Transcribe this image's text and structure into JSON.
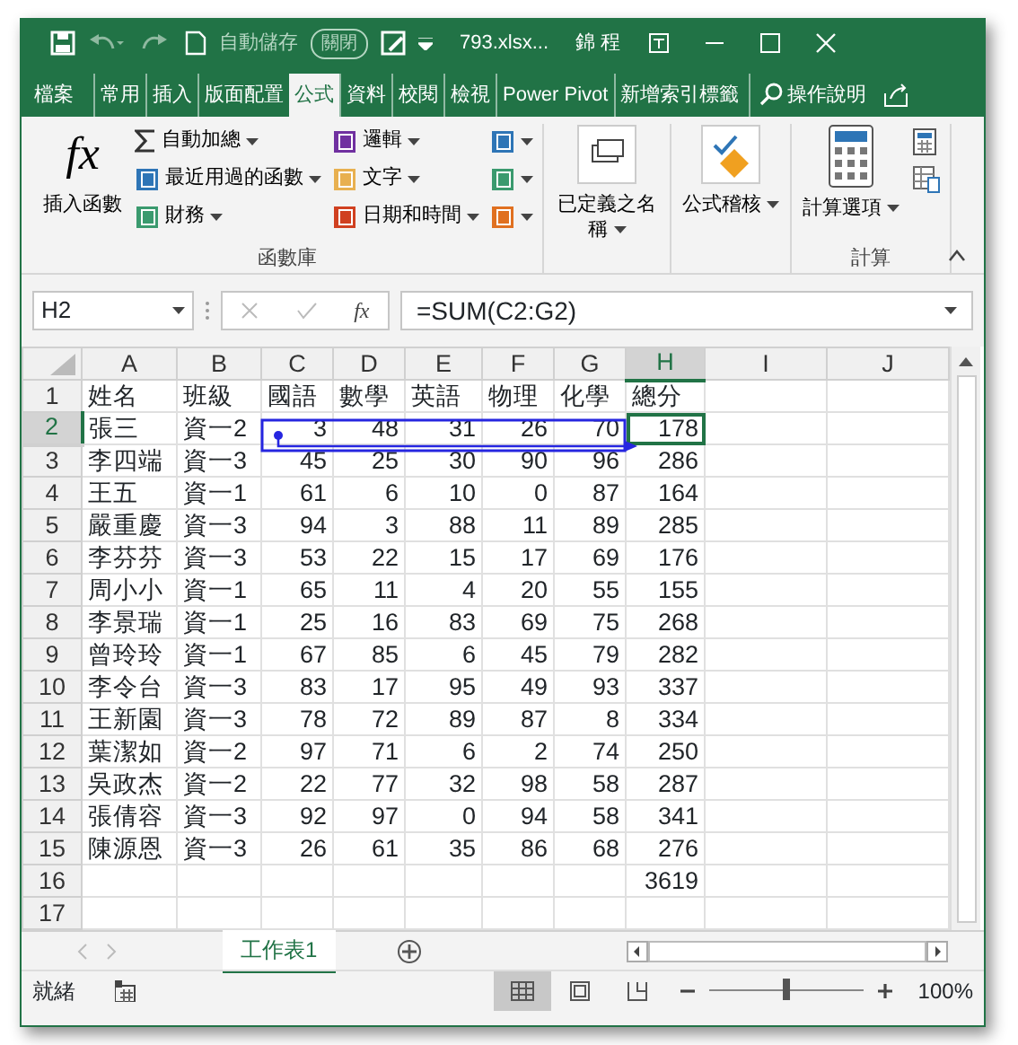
{
  "title_bar": {
    "autosave": {
      "label": "自動儲存",
      "toggle": "關閉",
      "on": false
    },
    "filename": "793.xlsx...",
    "user": "錦 程"
  },
  "tabs": [
    {
      "label": "檔案",
      "selected": false
    },
    {
      "label": "常用",
      "selected": false
    },
    {
      "label": "插入",
      "selected": false
    },
    {
      "label": "版面配置",
      "selected": false
    },
    {
      "label": "公式",
      "selected": true
    },
    {
      "label": "資料",
      "selected": false
    },
    {
      "label": "校閱",
      "selected": false
    },
    {
      "label": "檢視",
      "selected": false
    },
    {
      "label": "Power Pivot",
      "selected": false
    },
    {
      "label": "新增索引標籤",
      "selected": false
    }
  ],
  "tell_me": "操作說明",
  "ribbon": {
    "groups": [
      {
        "label": "函數庫",
        "items": [
          {
            "kind": "fx",
            "label": "插入函數",
            "dropdown": false
          },
          {
            "kind": "sum",
            "label": "自動加總",
            "dropdown": true
          },
          {
            "kind": "book",
            "color": "#2e75b6",
            "label": "最近用過的函數",
            "dropdown": true
          },
          {
            "kind": "book",
            "color": "#3a9a6e",
            "label": "財務",
            "dropdown": true
          },
          {
            "kind": "book",
            "color": "#7030a0",
            "label": "邏輯",
            "dropdown": true
          },
          {
            "kind": "book",
            "color": "#e8b050",
            "label": "文字",
            "dropdown": true
          },
          {
            "kind": "book",
            "color": "#d04020",
            "label": "日期和時間",
            "dropdown": true
          },
          {
            "kind": "book",
            "color": "#2e75b6",
            "dropdown": true
          },
          {
            "kind": "book",
            "color": "#3a9a6e",
            "dropdown": true
          },
          {
            "kind": "book",
            "color": "#e07020",
            "dropdown": true
          }
        ]
      },
      {
        "items": [
          {
            "kind": "names",
            "label": "已定義之名稱",
            "dropdown": true
          }
        ]
      },
      {
        "items": [
          {
            "kind": "audit",
            "label": "公式稽核",
            "dropdown": true
          }
        ]
      },
      {
        "label": "計算",
        "items": [
          {
            "kind": "calc_options",
            "label": "計算選項",
            "dropdown": true
          },
          {
            "kind": "calc"
          },
          {
            "kind": "sheet_calc"
          }
        ]
      }
    ]
  },
  "formula_bar": {
    "name_box": "H2",
    "fx_button": "fx",
    "formula": "=SUM(C2:G2)"
  },
  "columns": [
    {
      "label": "A",
      "selected": false
    },
    {
      "label": "B",
      "selected": false
    },
    {
      "label": "C",
      "selected": false
    },
    {
      "label": "D",
      "selected": false
    },
    {
      "label": "E",
      "selected": false
    },
    {
      "label": "F",
      "selected": false
    },
    {
      "label": "G",
      "selected": false
    },
    {
      "label": "H",
      "selected": true
    },
    {
      "label": "I",
      "selected": false
    },
    {
      "label": "J",
      "selected": false
    }
  ],
  "rows": [
    {
      "header": "1",
      "selected": false,
      "cells": [
        "姓名",
        "班級",
        "國語",
        "數學",
        "英語",
        "物理",
        "化學",
        "總分"
      ]
    },
    {
      "header": "2",
      "selected": true,
      "trace_precedents": true,
      "cells": [
        "張三",
        "資一2",
        "3",
        "48",
        "31",
        "26",
        "70",
        "178"
      ]
    },
    {
      "header": "3",
      "selected": false,
      "cells": [
        "李四端",
        "資一3",
        "45",
        "25",
        "30",
        "90",
        "96",
        "286"
      ]
    },
    {
      "header": "4",
      "selected": false,
      "cells": [
        "王五",
        "資一1",
        "61",
        "6",
        "10",
        "0",
        "87",
        "164"
      ]
    },
    {
      "header": "5",
      "selected": false,
      "cells": [
        "嚴重慶",
        "資一3",
        "94",
        "3",
        "88",
        "11",
        "89",
        "285"
      ]
    },
    {
      "header": "6",
      "selected": false,
      "cells": [
        "李芬芬",
        "資一3",
        "53",
        "22",
        "15",
        "17",
        "69",
        "176"
      ]
    },
    {
      "header": "7",
      "selected": false,
      "cells": [
        "周小小",
        "資一1",
        "65",
        "11",
        "4",
        "20",
        "55",
        "155"
      ]
    },
    {
      "header": "8",
      "selected": false,
      "cells": [
        "李景瑞",
        "資一1",
        "25",
        "16",
        "83",
        "69",
        "75",
        "268"
      ]
    },
    {
      "header": "9",
      "selected": false,
      "cells": [
        "曾玲玲",
        "資一1",
        "67",
        "85",
        "6",
        "45",
        "79",
        "282"
      ]
    },
    {
      "header": "10",
      "selected": false,
      "cells": [
        "李令台",
        "資一3",
        "83",
        "17",
        "95",
        "49",
        "93",
        "337"
      ]
    },
    {
      "header": "11",
      "selected": false,
      "cells": [
        "王新園",
        "資一3",
        "78",
        "72",
        "89",
        "87",
        "8",
        "334"
      ]
    },
    {
      "header": "12",
      "selected": false,
      "cells": [
        "葉潔如",
        "資一2",
        "97",
        "71",
        "6",
        "2",
        "74",
        "250"
      ]
    },
    {
      "header": "13",
      "selected": false,
      "cells": [
        "吳政杰",
        "資一2",
        "22",
        "77",
        "32",
        "98",
        "58",
        "287"
      ]
    },
    {
      "header": "14",
      "selected": false,
      "cells": [
        "張倩容",
        "資一3",
        "92",
        "97",
        "0",
        "94",
        "58",
        "341"
      ]
    },
    {
      "header": "15",
      "selected": false,
      "cells": [
        "陳源恩",
        "資一3",
        "26",
        "61",
        "35",
        "86",
        "68",
        "276"
      ]
    },
    {
      "header": "16",
      "selected": false,
      "cells": [
        null,
        null,
        null,
        null,
        null,
        null,
        null,
        "3619"
      ]
    },
    {
      "header": "17",
      "selected": false
    }
  ],
  "sheet_tabs": [
    {
      "label": "工作表1",
      "selected": true
    }
  ],
  "status_bar": {
    "status": "就緒",
    "views": [
      {
        "kind": "normal",
        "selected": true
      },
      {
        "kind": "layout",
        "selected": false
      },
      {
        "kind": "pagebreak",
        "selected": false
      }
    ],
    "zoom": {
      "level": 0.5,
      "reading": "100%"
    }
  }
}
